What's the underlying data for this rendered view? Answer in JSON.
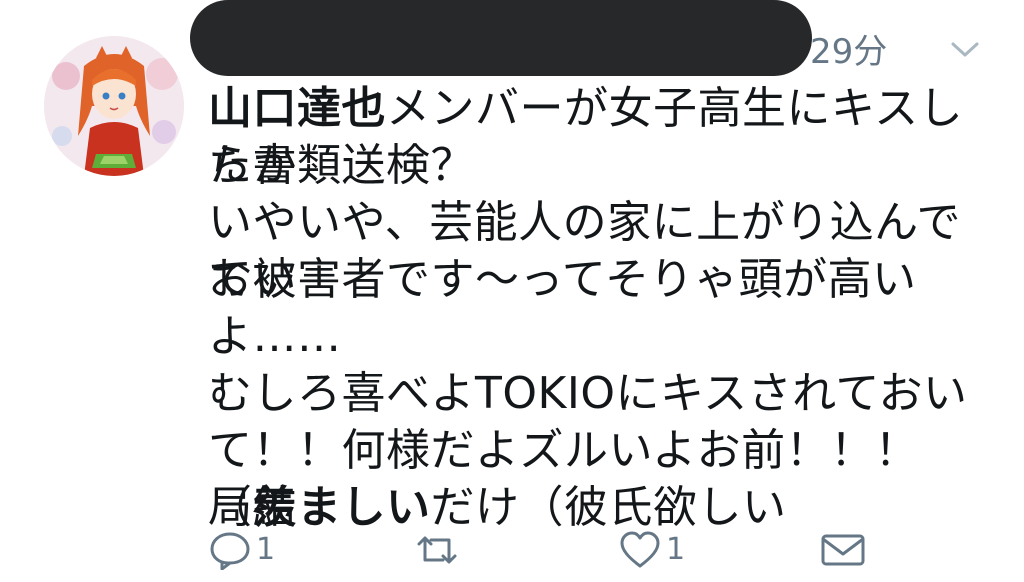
{
  "tweet": {
    "timestamp": "29分",
    "lines": [
      [
        {
          "t": "山口達也",
          "b": true
        },
        {
          "t": "メンバーが女子高生にキスしたか"
        }
      ],
      [
        {
          "t": "ら書類送検？"
        }
      ],
      [
        {
          "t": "いやいや、芸能人の家に上がり込んでおい"
        }
      ],
      [
        {
          "t": "て被害者です〜ってそりゃ頭が高いよ……"
        }
      ],
      [
        {
          "t": ""
        }
      ],
      [
        {
          "t": "むしろ喜べよTOKIOにキスされておい"
        }
      ],
      [
        {
          "t": "て！！何様だよズルいよお前！！！（結"
        }
      ],
      [
        {
          "t": "局"
        },
        {
          "t": "羨ましい",
          "b": true
        },
        {
          "t": "だけ（彼氏欲しい"
        }
      ]
    ],
    "actions": {
      "reply_count": "1",
      "retweet_count": "",
      "like_count": "1"
    }
  },
  "icons": {
    "reply": "reply-icon",
    "retweet": "retweet-icon",
    "like": "heart-icon",
    "dm": "envelope-icon",
    "more": "chevron-down-icon"
  },
  "colors": {
    "text": "#14171a",
    "meta": "#657786",
    "redaction": "#26282a"
  }
}
